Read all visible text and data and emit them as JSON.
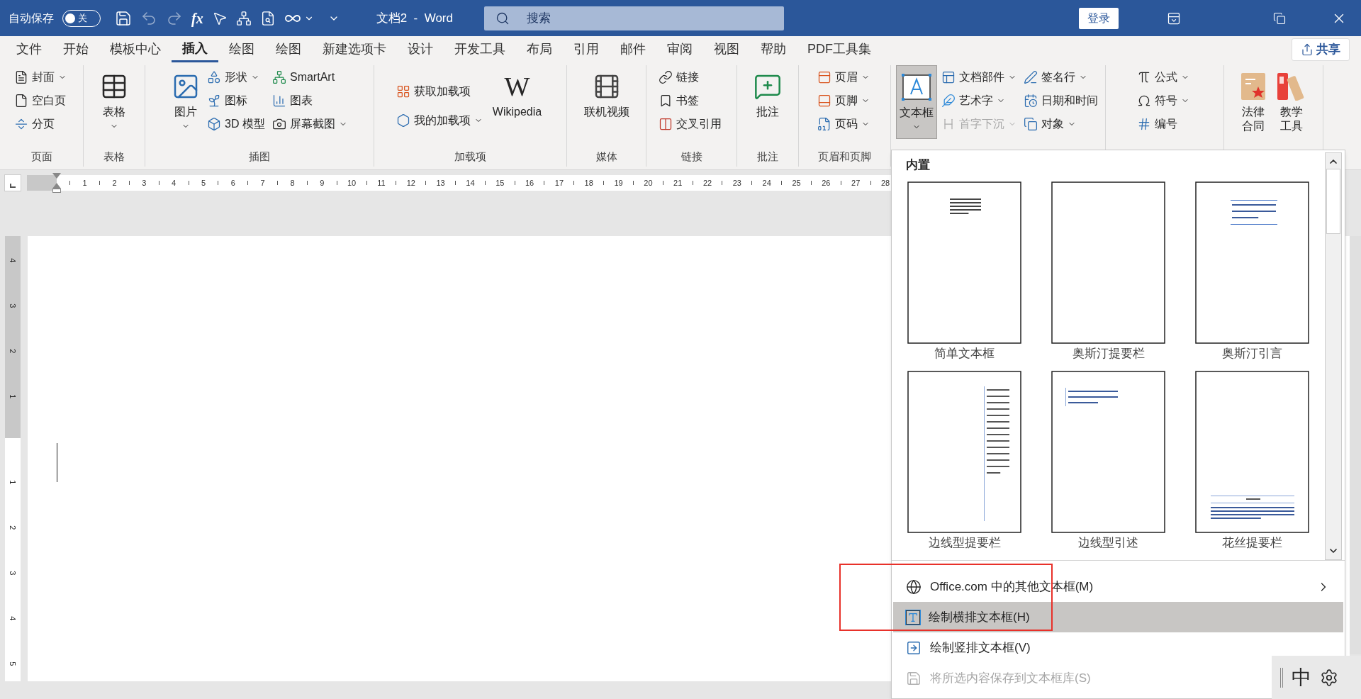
{
  "title_bar": {
    "autosave_label": "自动保存",
    "autosave_toggle": {
      "label": "关",
      "on": false
    },
    "formula_label": "fx",
    "title": "文档2  -  Word",
    "search": {
      "placeholder": "搜索"
    },
    "login": "登录"
  },
  "tabs": [
    {
      "label": "文件",
      "selected": false
    },
    {
      "label": "开始",
      "selected": false
    },
    {
      "label": "模板中心",
      "selected": false
    },
    {
      "label": "插入",
      "selected": true
    },
    {
      "label": "绘图",
      "selected": false
    },
    {
      "label": "绘图",
      "selected": false
    },
    {
      "label": "新建选项卡",
      "selected": false
    },
    {
      "label": "设计",
      "selected": false
    },
    {
      "label": "开发工具",
      "selected": false
    },
    {
      "label": "布局",
      "selected": false
    },
    {
      "label": "引用",
      "selected": false
    },
    {
      "label": "邮件",
      "selected": false
    },
    {
      "label": "审阅",
      "selected": false
    },
    {
      "label": "视图",
      "selected": false
    },
    {
      "label": "帮助",
      "selected": false
    },
    {
      "label": "PDF工具集",
      "selected": false
    }
  ],
  "share": "共享",
  "ribbon": {
    "groups": [
      {
        "label": "页面",
        "columns": [
          [
            {
              "kind": "small",
              "label": "封面",
              "dropdown": true
            },
            {
              "kind": "small",
              "label": "空白页",
              "dropdown": false
            },
            {
              "kind": "small",
              "label": "分页",
              "dropdown": false
            }
          ]
        ]
      },
      {
        "label": "表格",
        "columns": [
          [
            {
              "kind": "large",
              "label": "表格",
              "dropdown": true,
              "pressed": false
            }
          ]
        ]
      },
      {
        "label": "插图",
        "columns": [
          [
            {
              "kind": "large",
              "label": "图片",
              "dropdown": true,
              "pressed": false
            }
          ],
          [
            {
              "kind": "small",
              "label": "形状",
              "dropdown": true
            },
            {
              "kind": "small",
              "label": "图标",
              "dropdown": false
            },
            {
              "kind": "small",
              "label": "3D 模型",
              "dropdown": false
            }
          ],
          [
            {
              "kind": "small",
              "label": "SmartArt",
              "dropdown": false
            },
            {
              "kind": "small",
              "label": "图表",
              "dropdown": false
            },
            {
              "kind": "small",
              "label": "屏幕截图",
              "dropdown": true
            }
          ]
        ]
      },
      {
        "label": "加载项",
        "columns": [
          [
            {
              "kind": "small",
              "label": "获取加载项",
              "dropdown": false
            },
            {
              "kind": "small",
              "label": "我的加载项",
              "dropdown": true
            }
          ],
          [
            {
              "kind": "large",
              "label": "Wikipedia",
              "glyph": "W",
              "dropdown": false,
              "pressed": false
            }
          ]
        ]
      },
      {
        "label": "媒体",
        "columns": [
          [
            {
              "kind": "large",
              "label": "联机视频",
              "dropdown": false,
              "pressed": false
            }
          ]
        ]
      },
      {
        "label": "链接",
        "columns": [
          [
            {
              "kind": "small",
              "label": "链接",
              "dropdown": false
            },
            {
              "kind": "small",
              "label": "书签",
              "dropdown": false
            },
            {
              "kind": "small",
              "label": "交叉引用",
              "dropdown": false
            }
          ]
        ]
      },
      {
        "label": "批注",
        "columns": [
          [
            {
              "kind": "large",
              "label": "批注",
              "dropdown": false,
              "pressed": false
            }
          ]
        ]
      },
      {
        "label": "页眉和页脚",
        "columns": [
          [
            {
              "kind": "small",
              "label": "页眉",
              "dropdown": true
            },
            {
              "kind": "small",
              "label": "页脚",
              "dropdown": true
            },
            {
              "kind": "small",
              "label": "页码",
              "dropdown": true
            }
          ]
        ]
      },
      {
        "columns": [
          [
            {
              "kind": "large",
              "label": "文本框",
              "dropdown": true,
              "pressed": true
            }
          ],
          [
            {
              "kind": "small",
              "label": "文档部件",
              "dropdown": true,
              "disabled": false
            },
            {
              "kind": "small",
              "label": "艺术字",
              "dropdown": true,
              "disabled": false
            },
            {
              "kind": "small",
              "label": "首字下沉",
              "dropdown": true,
              "disabled": true
            }
          ],
          [
            {
              "kind": "small",
              "label": "签名行",
              "dropdown": true
            },
            {
              "kind": "small",
              "label": "日期和时间",
              "dropdown": false
            },
            {
              "kind": "small",
              "label": "对象",
              "dropdown": true
            }
          ]
        ]
      },
      {
        "columns": [
          [
            {
              "kind": "small",
              "label": "公式",
              "dropdown": true
            },
            {
              "kind": "small",
              "label": "符号",
              "dropdown": true
            },
            {
              "kind": "small",
              "label": "编号",
              "dropdown": false
            }
          ]
        ]
      },
      {
        "columns": [
          [
            {
              "kind": "large",
              "label": "法律合同",
              "dropdown": false,
              "pressed": false
            }
          ],
          [
            {
              "kind": "large",
              "label": "教学工具",
              "dropdown": false,
              "pressed": false
            }
          ]
        ]
      }
    ]
  },
  "ruler": {
    "marks": [
      "1",
      "2",
      "3",
      "4",
      "5",
      "6",
      "7",
      "8",
      "9",
      "10",
      "11",
      "12",
      "13",
      "14",
      "15",
      "16",
      "17",
      "18",
      "19",
      "20",
      "21",
      "22",
      "23",
      "24",
      "25",
      "26",
      "27",
      "28"
    ]
  },
  "vertical_ruler": {
    "top_marks": [
      "4",
      "3",
      "2",
      "1"
    ],
    "body_marks": [
      "1",
      "2",
      "3",
      "4",
      "5"
    ]
  },
  "textbox_menu": {
    "section": "内置",
    "gallery": [
      {
        "kind": "simple",
        "label": "简单文本框"
      },
      {
        "kind": "blank",
        "label": "奥斯汀提要栏"
      },
      {
        "kind": "quote",
        "label": "奥斯汀引言"
      },
      {
        "kind": "sidebar",
        "label": "边线型提要栏"
      },
      {
        "kind": "line-quote",
        "label": "边线型引述"
      },
      {
        "kind": "banner",
        "label": "花丝提要栏"
      }
    ],
    "items": [
      {
        "label": "Office.com 中的其他文本框(M)",
        "submenu": true,
        "highlighted": false,
        "disabled": false
      },
      {
        "label": "绘制横排文本框(H)",
        "submenu": false,
        "highlighted": true,
        "disabled": false
      },
      {
        "label": "绘制竖排文本框(V)",
        "submenu": false,
        "highlighted": false,
        "disabled": false
      },
      {
        "label": "将所选内容保存到文本框库(S)",
        "submenu": false,
        "highlighted": false,
        "disabled": true
      }
    ]
  },
  "ime": {
    "label": "中"
  }
}
